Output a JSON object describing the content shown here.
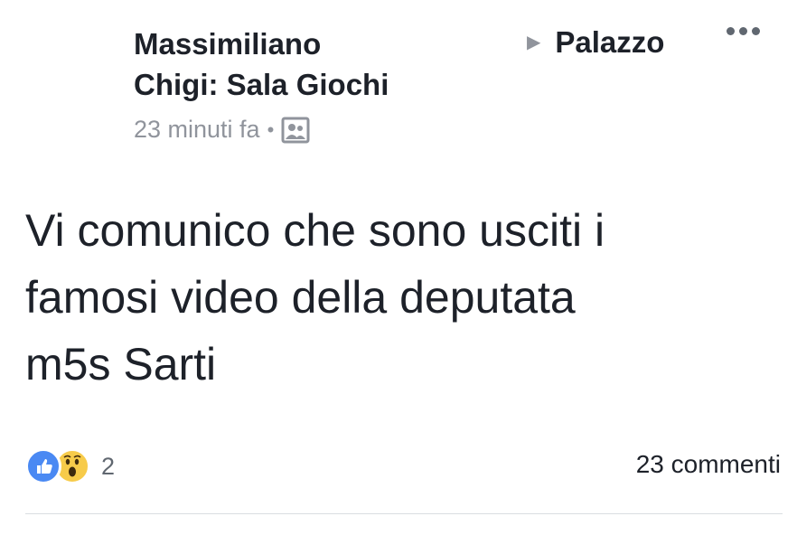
{
  "post": {
    "author_line1": "Massimiliano",
    "author_line2": "Chigi: Sala Giochi",
    "share_target": "Palazzo",
    "time": "23 minuti fa",
    "separator": "•",
    "audience_icon": "photo-group-icon",
    "text": "Vi comunico che sono usciti i\nfamosi video della deputata\nm5s Sarti"
  },
  "footer": {
    "reaction_icons": [
      "like-icon",
      "wow-icon"
    ],
    "reaction_count": "2",
    "comments_label": "23 commenti"
  },
  "colors": {
    "like": "#4a89f3",
    "wow": "#f7cb4a",
    "meta_text": "#90949c",
    "divider": "#dadde1"
  }
}
